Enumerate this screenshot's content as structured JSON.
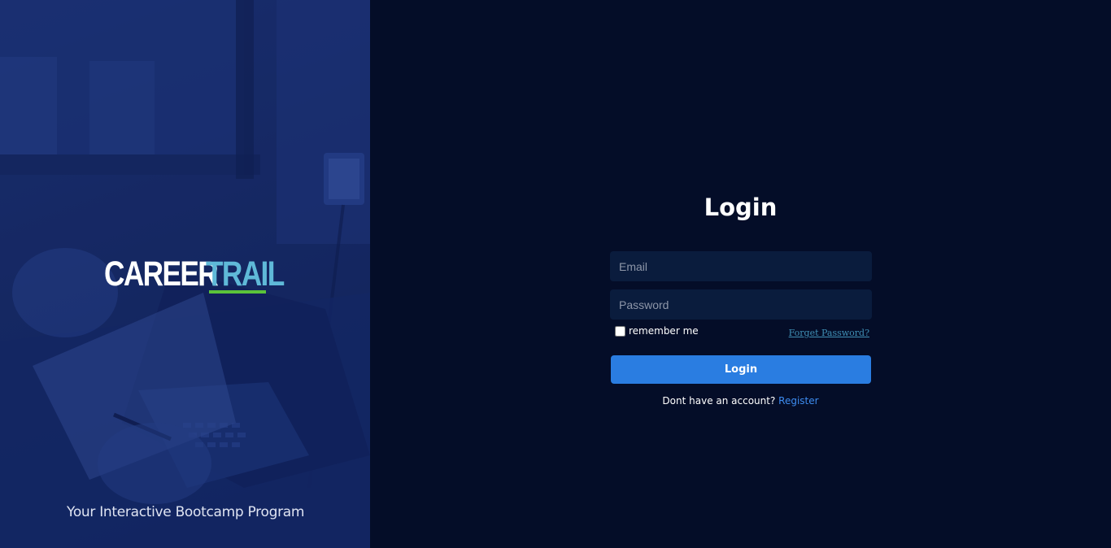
{
  "brand": {
    "logo_word_1": "CAREER",
    "logo_word_2": "TRAIL",
    "tagline": "Your Interactive Bootcamp Program",
    "colors": {
      "logo_accent": "#5fb9d8",
      "logo_underline": "#5bc43a",
      "hero_overlay": "#1b2f6e"
    }
  },
  "login": {
    "title": "Login",
    "email_placeholder": "Email",
    "email_value": "",
    "password_placeholder": "Password",
    "password_value": "",
    "remember_label": "remember me",
    "remember_checked": false,
    "forgot_label": "Forget Password?",
    "submit_label": "Login",
    "register_prompt": "Dont have an account?",
    "register_link": "Register",
    "colors": {
      "background": "#040d28",
      "field_background": "#0a1c3d",
      "button": "#2a7de1",
      "link": "#3d8cf0"
    }
  }
}
